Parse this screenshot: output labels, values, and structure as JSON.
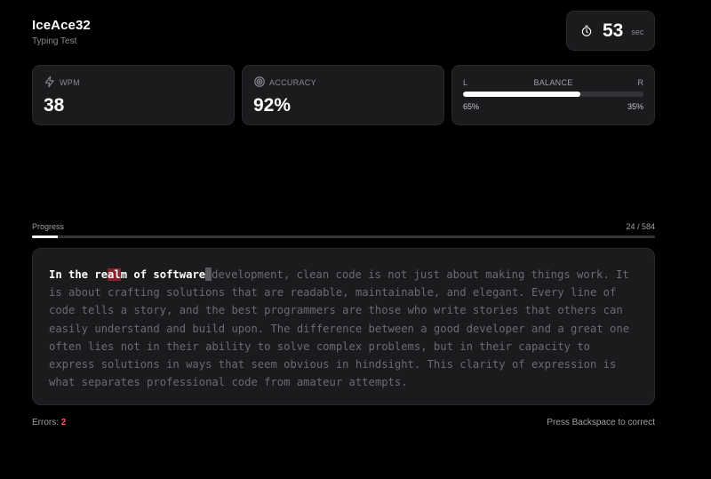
{
  "header": {
    "username": "IceAce32",
    "subtitle": "Typing Test"
  },
  "timer": {
    "value": "53",
    "unit": "sec",
    "icon": "stopwatch-icon"
  },
  "stats": {
    "wpm": {
      "label": "WPM",
      "value": "38",
      "icon": "lightning-icon"
    },
    "accuracy": {
      "label": "ACCURACY",
      "value": "92%",
      "icon": "target-icon"
    },
    "balance": {
      "left": "L",
      "label": "BALANCE",
      "right": "R",
      "left_pct": "65%",
      "right_pct": "35%",
      "left_fraction": 0.65
    }
  },
  "progress": {
    "label": "Progress",
    "count": "24 / 584",
    "fraction": 0.041
  },
  "passage": {
    "typed_segments": [
      "In the re",
      "al",
      "m of software"
    ],
    "cursor_char": " ",
    "remaining": "development, clean code is not just about making things work. It is about crafting solutions that are readable, maintainable, and elegant. Every line of code tells a story, and the best programmers are those who write stories that others can easily understand and build upon. The difference between a good developer and a great one often lies not in their ability to solve complex problems, but in their capacity to express solutions in ways that seem obvious in hindsight. This clarity of expression is what separates professional code from amateur attempts."
  },
  "footer": {
    "errors_label": "Errors:",
    "errors_count": "2",
    "hint": "Press Backspace to correct"
  },
  "colors": {
    "background": "#000000",
    "card": "#1b1b1e",
    "error": "#ff4d5e",
    "error_bg": "#8b1e2b"
  }
}
